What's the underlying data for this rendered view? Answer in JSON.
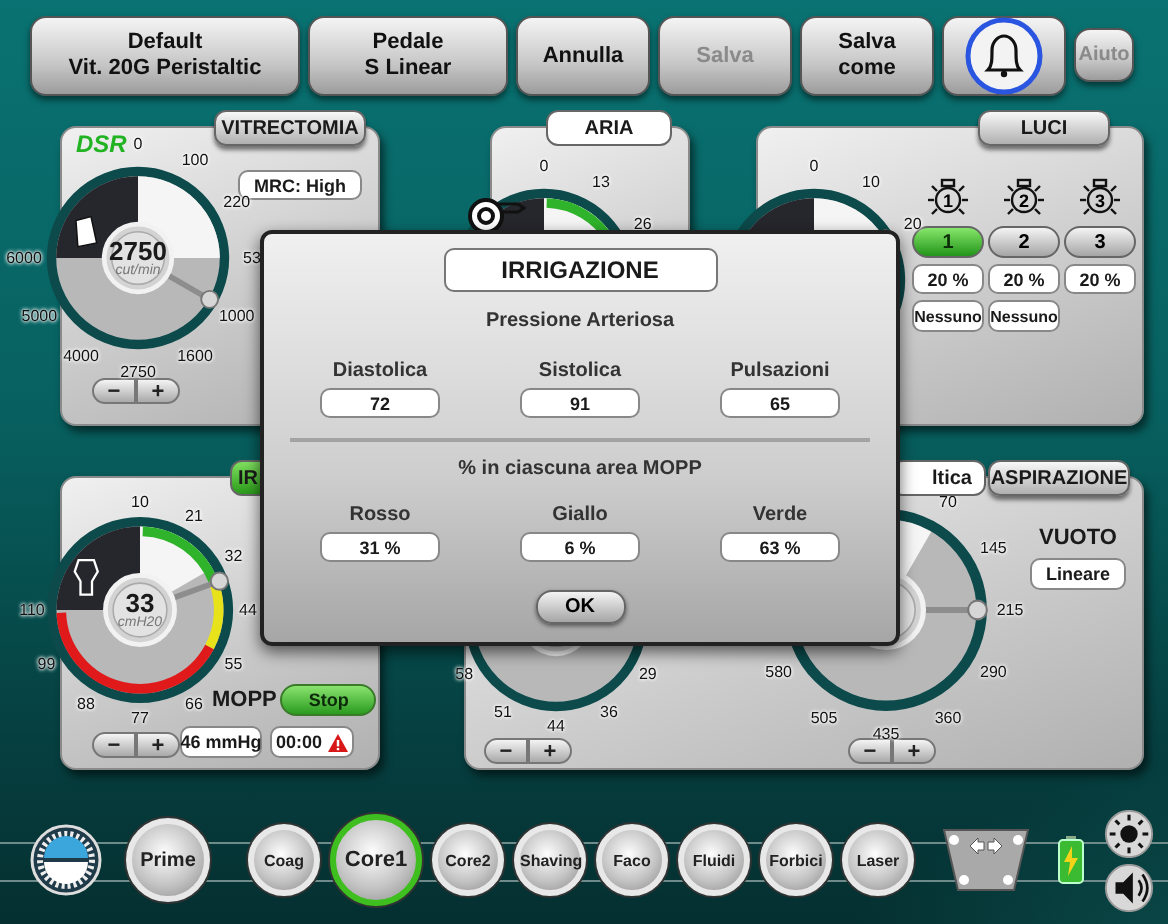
{
  "toolbar": [
    {
      "kind": "text",
      "label": "Default\nVit. 20G Peristaltic",
      "disabled": false
    },
    {
      "kind": "text",
      "label": "Pedale\nS Linear",
      "disabled": false
    },
    {
      "kind": "text",
      "label": "Annulla",
      "disabled": false
    },
    {
      "kind": "text",
      "label": "Salva",
      "disabled": true
    },
    {
      "kind": "text",
      "label": "Salva\ncome",
      "disabled": false
    },
    {
      "kind": "bell"
    },
    {
      "kind": "small",
      "label": "Aiuto",
      "disabled": true
    }
  ],
  "vitrectomy": {
    "tab": {
      "label": "VITRECTOMIA",
      "kind": "grey"
    },
    "mode": "DSR",
    "mrc": "MRC: High",
    "gauge": {
      "ticks": [
        "0",
        "100",
        "220",
        "53",
        "1000",
        "1600",
        "2750",
        "4000",
        "5000",
        "6000"
      ],
      "value": "2750",
      "unit": "cut/min"
    },
    "stepper": [
      "−",
      "+"
    ]
  },
  "air": {
    "tab": {
      "label": "ARIA",
      "kind": "white"
    },
    "gauge": {
      "ticks": [
        "0",
        "13",
        "26"
      ]
    }
  },
  "lights": {
    "tab": {
      "label": "LUCI",
      "kind": "grey"
    },
    "gauge": {
      "ticks": [
        "0",
        "10",
        "20"
      ]
    },
    "lamps": [
      {
        "number": "1",
        "button": "1",
        "selected": true,
        "intensity": "20 %",
        "mode": "Nessuno"
      },
      {
        "number": "2",
        "button": "2",
        "selected": false,
        "intensity": "20 %",
        "mode": "Nessuno"
      },
      {
        "number": "3",
        "button": "3",
        "selected": false,
        "intensity": "20 %"
      }
    ]
  },
  "irrigation": {
    "tab": {
      "label": "IR",
      "kind": "green"
    },
    "gauge": {
      "ticks": [
        "10",
        "21",
        "32",
        "44",
        "55",
        "66",
        "77",
        "88",
        "99",
        "110"
      ],
      "value": "33",
      "unit": "cmH20"
    },
    "stepper": [
      "−",
      "+"
    ],
    "mopp_label": "MOPP",
    "stop_button": "Stop",
    "pressure": "46 mmHg",
    "timer": "00:00"
  },
  "aspiration": {
    "tabs": [
      {
        "label": "ltica",
        "kind": "white"
      },
      {
        "label": "ASPIRAZIONE",
        "kind": "grey"
      }
    ],
    "gauges": [
      {
        "ticks": [
          "29",
          "36",
          "44",
          "51",
          "58"
        ],
        "stepper": [
          "−",
          "+"
        ]
      },
      {
        "ticks": [
          "70",
          "145",
          "215",
          "290",
          "360",
          "435",
          "505",
          "580"
        ],
        "stepper": [
          "−",
          "+"
        ]
      }
    ],
    "vacuum_label": "VUOTO",
    "vacuum_mode": "Lineare"
  },
  "dialog": {
    "title": "IRRIGAZIONE",
    "section_1": "Pressione Arteriosa",
    "readings": [
      {
        "label": "Diastolica",
        "value": "72"
      },
      {
        "label": "Sistolica",
        "value": "91"
      },
      {
        "label": "Pulsazioni",
        "value": "65"
      }
    ],
    "section_2": "% in ciascuna area MOPP",
    "zones": [
      {
        "label": "Rosso",
        "value": "31 %"
      },
      {
        "label": "Giallo",
        "value": "6 %"
      },
      {
        "label": "Verde",
        "value": "63 %"
      }
    ],
    "ok": "OK"
  },
  "bottom_bar": {
    "prime": "Prime",
    "modes": [
      {
        "label": "Coag",
        "selected": false
      },
      {
        "label": "Core1",
        "selected": true
      },
      {
        "label": "Core2",
        "selected": false
      },
      {
        "label": "Shaving",
        "selected": false
      },
      {
        "label": "Faco",
        "selected": false
      },
      {
        "label": "Fluidi",
        "selected": false
      },
      {
        "label": "Forbici",
        "selected": false
      },
      {
        "label": "Laser",
        "selected": false
      }
    ]
  }
}
